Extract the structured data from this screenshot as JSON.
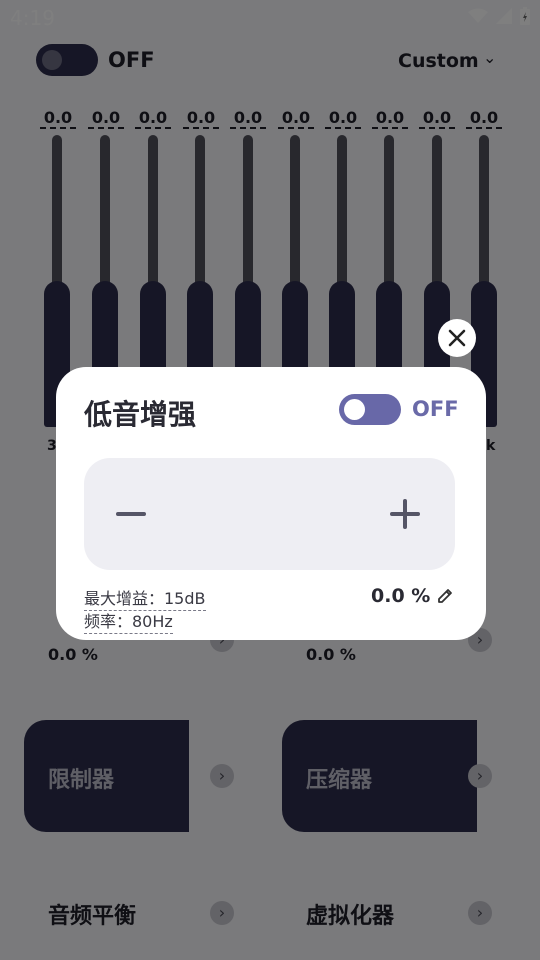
{
  "status": {
    "time": "4:19"
  },
  "header": {
    "power_label": "OFF",
    "preset": "Custom"
  },
  "equalizer": {
    "values": [
      "0.0",
      "0.0",
      "0.0",
      "0.0",
      "0.0",
      "0.0",
      "0.0",
      "0.0",
      "0.0",
      "0.0"
    ],
    "first_band_label": "3",
    "last_band_label": "k"
  },
  "tiles": {
    "left_pct": "0.0 %",
    "right_pct": "0.0 %",
    "limiter": "限制器",
    "compressor": "压缩器",
    "audio_balance": "音频平衡",
    "virtualizer": "虚拟化器"
  },
  "dialog": {
    "title": "低音增强",
    "toggle_label": "OFF",
    "max_gain": "最大增益：15dB",
    "frequency": "频率：80Hz",
    "percent": "0.0 %"
  }
}
